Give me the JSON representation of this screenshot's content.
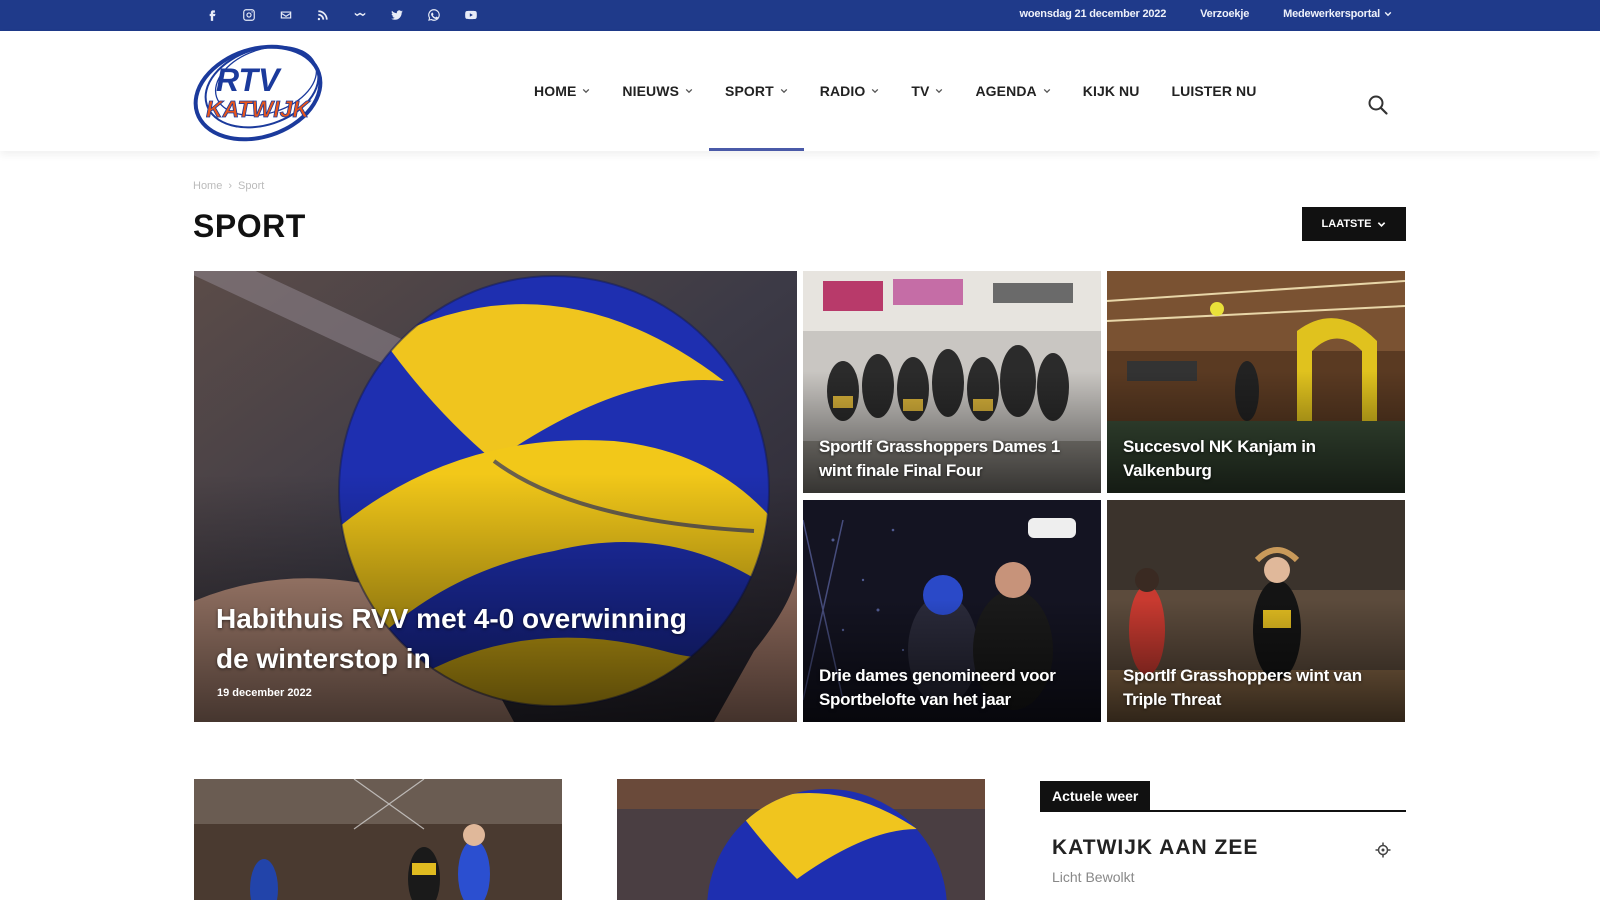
{
  "topbar": {
    "social_icons": [
      "facebook-icon",
      "instagram-icon",
      "mail-icon",
      "rss-icon",
      "tiktok-icon",
      "twitter-icon",
      "whatsapp-icon",
      "youtube-icon"
    ],
    "date": "woensdag 21 december 2022",
    "links": [
      {
        "label": "Verzoekje"
      },
      {
        "label": "Medewerkersportal"
      }
    ]
  },
  "logo": {
    "line1": "RTV",
    "line2": "KATWIJK"
  },
  "nav": {
    "items": [
      {
        "label": "HOME",
        "dropdown": true
      },
      {
        "label": "NIEUWS",
        "dropdown": true
      },
      {
        "label": "SPORT",
        "dropdown": true,
        "active": true
      },
      {
        "label": "RADIO",
        "dropdown": true
      },
      {
        "label": "TV",
        "dropdown": true
      },
      {
        "label": "AGENDA",
        "dropdown": true
      },
      {
        "label": "KIJK NU",
        "dropdown": false
      },
      {
        "label": "LUISTER NU",
        "dropdown": false
      }
    ],
    "accent_color": "#4a5aa8"
  },
  "breadcrumb": {
    "home": "Home",
    "separator": "›",
    "current": "Sport"
  },
  "page": {
    "title": "SPORT",
    "sort_label": "LAATSTE"
  },
  "featured": {
    "main": {
      "title": "Habithuis RVV met 4-0 overwinning de winterstop in",
      "date": "19 december 2022"
    },
    "tiles": [
      {
        "title": "Sportlf Grasshoppers Dames 1 wint finale Final Four"
      },
      {
        "title": "Succesvol NK Kanjam in Valkenburg"
      },
      {
        "title": "Drie dames genomineerd voor Sportbelofte van het jaar"
      },
      {
        "title": "Sportlf Grasshoppers wint van Triple Threat"
      }
    ]
  },
  "weather": {
    "tab": "Actuele weer",
    "city": "KATWIJK AAN ZEE",
    "description": "Licht Bewolkt"
  },
  "colors": {
    "topbar": "#1f3a8a",
    "logo_blue": "#1b3a9c",
    "logo_orange": "#e8561c"
  }
}
